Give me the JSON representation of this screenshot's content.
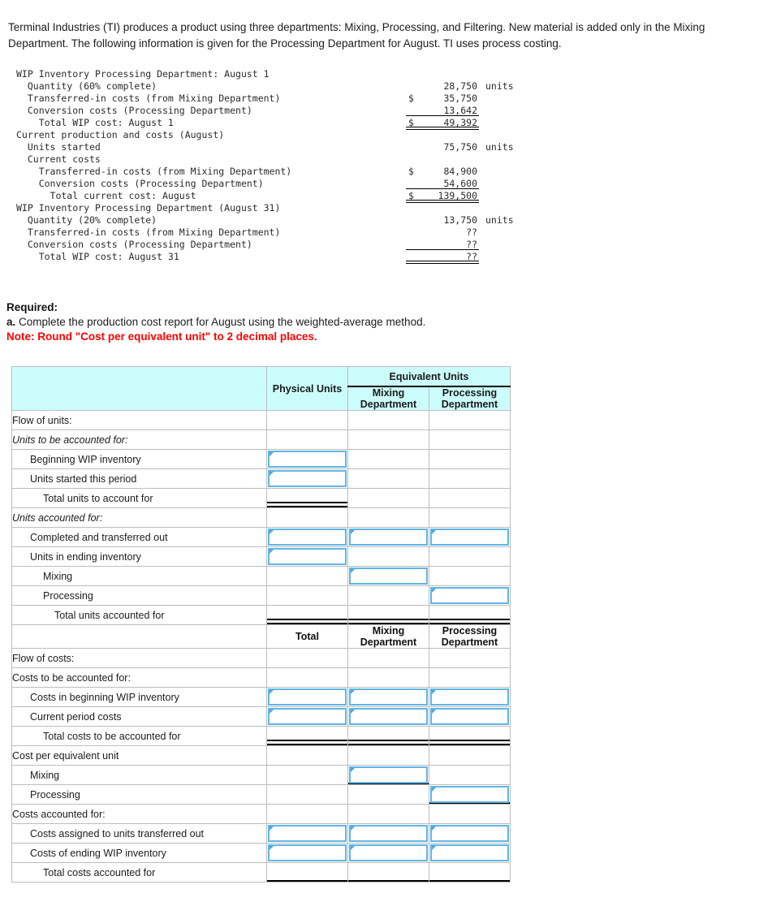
{
  "intro": "Terminal Industries (TI) produces a product using three departments: Mixing, Processing, and Filtering. New material is added only in the Mixing Department. The following information is given for the Processing Department for August. TI uses process costing.",
  "data_block": {
    "rows": [
      {
        "label": "WIP Inventory Processing Department: August 1",
        "indent": 0,
        "amount": "",
        "currency": "",
        "unit": "",
        "rule": "none"
      },
      {
        "label": "Quantity (60% complete)",
        "indent": 1,
        "amount": "28,750",
        "currency": "",
        "unit": "units",
        "rule": "none"
      },
      {
        "label": "Transferred-in costs (from Mixing Department)",
        "indent": 1,
        "amount": "35,750",
        "currency": "$",
        "unit": "",
        "rule": "none"
      },
      {
        "label": "Conversion costs (Processing Department)",
        "indent": 1,
        "amount": "13,642",
        "currency": "",
        "unit": "",
        "rule": "single"
      },
      {
        "label": "Total WIP cost: August 1",
        "indent": 2,
        "amount": "49,392",
        "currency": "$",
        "unit": "",
        "rule": "double"
      },
      {
        "label": "Current production and costs (August)",
        "indent": 0,
        "amount": "",
        "currency": "",
        "unit": "",
        "rule": "none"
      },
      {
        "label": "Units started",
        "indent": 1,
        "amount": "75,750",
        "currency": "",
        "unit": "units",
        "rule": "none"
      },
      {
        "label": "Current costs",
        "indent": 1,
        "amount": "",
        "currency": "",
        "unit": "",
        "rule": "none"
      },
      {
        "label": "Transferred-in costs (from Mixing Department)",
        "indent": 2,
        "amount": "84,900",
        "currency": "$",
        "unit": "",
        "rule": "none"
      },
      {
        "label": "Conversion costs (Processing Department)",
        "indent": 2,
        "amount": "54,600",
        "currency": "",
        "unit": "",
        "rule": "single"
      },
      {
        "label": "Total current cost: August",
        "indent": 3,
        "amount": "139,500",
        "currency": "$",
        "unit": "",
        "rule": "double"
      },
      {
        "label": "WIP Inventory Processing Department (August 31)",
        "indent": 0,
        "amount": "",
        "currency": "",
        "unit": "",
        "rule": "none"
      },
      {
        "label": "Quantity (20% complete)",
        "indent": 1,
        "amount": "13,750",
        "currency": "",
        "unit": "units",
        "rule": "none"
      },
      {
        "label": "Transferred-in costs (from Mixing Department)",
        "indent": 1,
        "amount": "??",
        "currency": "",
        "unit": "",
        "rule": "none"
      },
      {
        "label": "Conversion costs (Processing Department)",
        "indent": 1,
        "amount": "??",
        "currency": "",
        "unit": "",
        "rule": "single"
      },
      {
        "label": "Total WIP cost: August 31",
        "indent": 2,
        "amount": "??",
        "currency": "",
        "unit": "",
        "rule": "double"
      }
    ]
  },
  "required": {
    "heading": "Required:",
    "item_a_marker": "a.",
    "item_a_text": "Complete the production cost report for August using the weighted-average method.",
    "note": "Note: Round \"Cost per equivalent unit\" to 2 decimal places."
  },
  "report": {
    "header": {
      "blank": "",
      "physical_units": "Physical Units",
      "equivalent_units": "Equivalent Units",
      "mixing_line1": "Mixing",
      "mixing_line2": "Department",
      "processing_line1": "Processing",
      "processing_line2": "Department"
    },
    "header2": {
      "blank": "",
      "total": "Total",
      "mixing_line1": "Mixing",
      "mixing_line2": "Department",
      "processing_line1": "Processing",
      "processing_line2": "Department"
    },
    "units_rows": [
      {
        "label": "Flow of units:",
        "indent": 0,
        "italic": false,
        "cells": [
          "",
          "",
          ""
        ]
      },
      {
        "label": "Units to be accounted for:",
        "indent": 0,
        "italic": true,
        "cells": [
          "",
          "",
          ""
        ]
      },
      {
        "label": "Beginning WIP inventory",
        "indent": 1,
        "italic": false,
        "cells": [
          "input",
          "",
          ""
        ]
      },
      {
        "label": "Units started this period",
        "indent": 1,
        "italic": false,
        "cells": [
          "input",
          "",
          ""
        ]
      },
      {
        "label": "Total units to account for",
        "indent": 2,
        "italic": false,
        "cells": [
          "total2",
          "",
          ""
        ]
      },
      {
        "label": "Units accounted for:",
        "indent": 0,
        "italic": true,
        "cells": [
          "",
          "",
          ""
        ]
      },
      {
        "label": "Completed and transferred out",
        "indent": 1,
        "italic": false,
        "cells": [
          "input",
          "input",
          "input"
        ]
      },
      {
        "label": "Units in ending inventory",
        "indent": 1,
        "italic": false,
        "cells": [
          "input",
          "",
          ""
        ]
      },
      {
        "label": "Mixing",
        "indent": 2,
        "italic": false,
        "cells": [
          "",
          "input",
          ""
        ]
      },
      {
        "label": "Processing",
        "indent": 2,
        "italic": false,
        "cells": [
          "",
          "",
          "input"
        ]
      },
      {
        "label": "Total units accounted for",
        "indent": 3,
        "italic": false,
        "cells": [
          "total2",
          "total2",
          "total2"
        ]
      }
    ],
    "cost_rows": [
      {
        "label": "Flow of costs:",
        "indent": 0,
        "italic": false,
        "cells": [
          "",
          "",
          ""
        ]
      },
      {
        "label": "Costs to be accounted for:",
        "indent": 0,
        "italic": false,
        "cells": [
          "",
          "",
          ""
        ]
      },
      {
        "label": "Costs in beginning WIP inventory",
        "indent": 1,
        "italic": false,
        "cells": [
          "input",
          "input",
          "input"
        ]
      },
      {
        "label": "Current period costs",
        "indent": 1,
        "italic": false,
        "cells": [
          "input",
          "input",
          "input"
        ]
      },
      {
        "label": "Total costs to be accounted for",
        "indent": 2,
        "italic": false,
        "cells": [
          "total2",
          "total2",
          "total2"
        ]
      },
      {
        "label": "Cost per equivalent unit",
        "indent": 0,
        "italic": false,
        "cells": [
          "",
          "",
          ""
        ]
      },
      {
        "label": "Mixing",
        "indent": 1,
        "italic": false,
        "cells": [
          "",
          "input1",
          ""
        ]
      },
      {
        "label": "Processing",
        "indent": 1,
        "italic": false,
        "cells": [
          "",
          "",
          "input1"
        ]
      },
      {
        "label": "Costs accounted for:",
        "indent": 0,
        "italic": false,
        "cells": [
          "",
          "",
          ""
        ]
      },
      {
        "label": "Costs assigned to units transferred out",
        "indent": 1,
        "italic": false,
        "cells": [
          "input",
          "input",
          "input"
        ]
      },
      {
        "label": "Costs of ending WIP inventory",
        "indent": 1,
        "italic": false,
        "cells": [
          "input",
          "input",
          "input"
        ]
      },
      {
        "label": "Total costs accounted for",
        "indent": 2,
        "italic": false,
        "cells": [
          "total1",
          "total1",
          "total1"
        ]
      }
    ]
  },
  "colors": {
    "header_fill": "#ccfdfd",
    "input_border": "#62b5e5",
    "note_red": "#ff0000"
  }
}
